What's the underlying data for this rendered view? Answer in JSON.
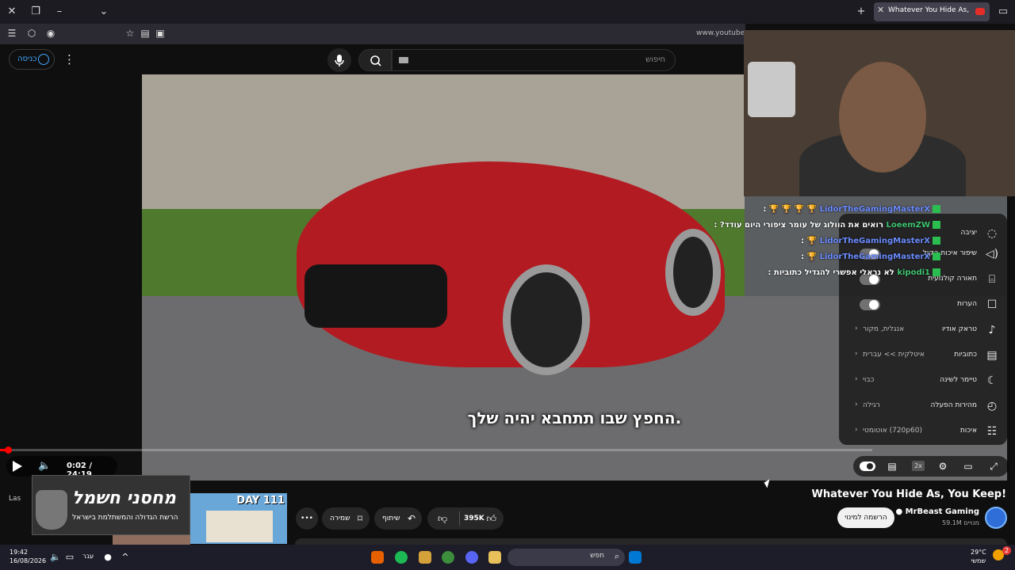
{
  "browser": {
    "tab_title": "Whatever You Hide As, You Keep!",
    "url": "www.youtube.c"
  },
  "header": {
    "sign_in_label": "כניסה",
    "search_placeholder": "חיפוש"
  },
  "video": {
    "subtitle": "החפץ שבו תתחבא יהיה שלך.",
    "time_current": "0:02",
    "time_separator": " / ",
    "time_total": "24:19",
    "progress_fraction": 0.0014,
    "speed_badge": "2x"
  },
  "chat": [
    {
      "user": "LidorTheGamingMasterX",
      "message": "🏆 🏆 🏆 🏆 :",
      "user_color": "#6b8cff"
    },
    {
      "user": "LoeemZW",
      "message": "רואים את הוולוג של עומר ציפורי היום עודד? :",
      "user_color": "#3fc36f"
    },
    {
      "user": "LidorTheGamingMasterX",
      "message": "🏆 :",
      "user_color": "#6b8cff"
    },
    {
      "user": "LidorTheGamingMasterX",
      "message": "🏆 :",
      "user_color": "#6b8cff"
    },
    {
      "user": "kipodi1",
      "message": "לא נראלי אפשרי להגדיל כתוביות :",
      "user_color": "#3fc36f"
    }
  ],
  "settings": {
    "partial_label": "יציבה",
    "rows": [
      {
        "label": "שיפור איכות הקול",
        "value": "",
        "icon": "audio-enhance-icon",
        "toggle": true
      },
      {
        "label": "תאורה קולנועית",
        "value": "",
        "icon": "ambient-mode-icon",
        "toggle": true
      },
      {
        "label": "הערות",
        "value": "",
        "icon": "annotations-icon",
        "toggle": true
      },
      {
        "label": "טראק אודיו",
        "value": "אנגלית, מקור",
        "icon": "audio-track-icon",
        "toggle": false
      },
      {
        "label": "כתוביות",
        "value": "איטלקית >> עברית",
        "icon": "subtitles-icon",
        "toggle": false
      },
      {
        "label": "טיימר לשינה",
        "value": "כבוי",
        "icon": "sleep-timer-icon",
        "toggle": false
      },
      {
        "label": "מהירות הפעלה",
        "value": "רגילה",
        "icon": "playback-speed-icon",
        "toggle": false
      },
      {
        "label": "איכות",
        "value": "אוטומטי (720p60)",
        "icon": "quality-icon",
        "toggle": false
      }
    ]
  },
  "below_video": {
    "title": "Whatever You Hide As, You Keep!",
    "channel_name": "MrBeast Gaming",
    "subscribers": "59.1M מנויים",
    "subscribe_label": "הרשמה למינוי",
    "likes": "395K",
    "share_label": "שיתוף",
    "save_label": "שמירה",
    "more_label": "•••"
  },
  "sidebar": {
    "thumb_label": "DAY 111",
    "last_label": "Las",
    "ad_title": "מחסני חשמל",
    "ad_subtitle": "הרשת הגדולה והמשתלמת בישראל"
  },
  "taskbar": {
    "time": "19:42",
    "date": "16/08/2026",
    "language": "עבר",
    "search_placeholder": "חפש",
    "temperature": "29°C",
    "weather": "שמשי",
    "notification_count": "2"
  }
}
